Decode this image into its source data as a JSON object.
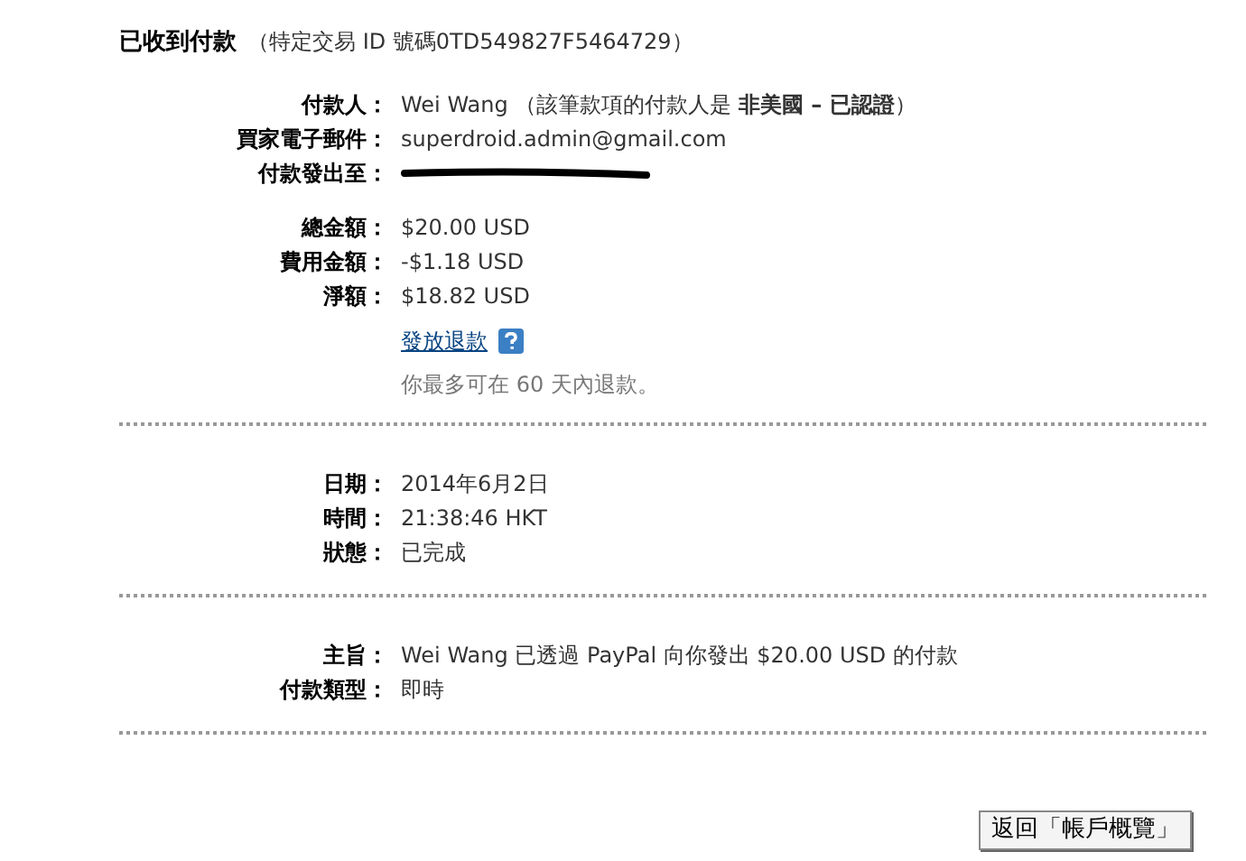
{
  "header": {
    "title": "已收到付款",
    "transaction": "（特定交易 ID 號碼0TD549827F5464729）"
  },
  "sections": [
    {
      "rows": [
        {
          "kind": "text",
          "label": "付款人：",
          "value": "Wei Wang （該筆款項的付款人是 **非美國 – 已認證**）"
        },
        {
          "kind": "text",
          "label": "買家電子郵件：",
          "value": "superdroid.admin@gmail.com"
        },
        {
          "kind": "redacted",
          "label": "付款發出至："
        },
        {
          "kind": "gap"
        },
        {
          "kind": "text",
          "label": "總金額：",
          "value": "$20.00 USD"
        },
        {
          "kind": "text",
          "label": "費用金額：",
          "value": "-$1.18 USD"
        },
        {
          "kind": "text",
          "label": "淨額：",
          "value": "$18.82 USD"
        },
        {
          "kind": "link",
          "value": "發放退款"
        },
        {
          "kind": "note",
          "value": "你最多可在 60 天內退款。"
        }
      ]
    },
    {
      "rows": [
        {
          "kind": "text",
          "label": "日期：",
          "value": "2014年6月2日"
        },
        {
          "kind": "text",
          "label": "時間：",
          "value": "21:38:46 HKT"
        },
        {
          "kind": "text",
          "label": "狀態：",
          "value": "已完成"
        }
      ]
    },
    {
      "rows": [
        {
          "kind": "text",
          "label": "主旨：",
          "value": "Wei Wang 已透過 PayPal 向你發出 $20.00 USD 的付款"
        },
        {
          "kind": "text",
          "label": "付款類型：",
          "value": "即時"
        }
      ]
    }
  ],
  "back_button": "返回「帳戶概覽」"
}
